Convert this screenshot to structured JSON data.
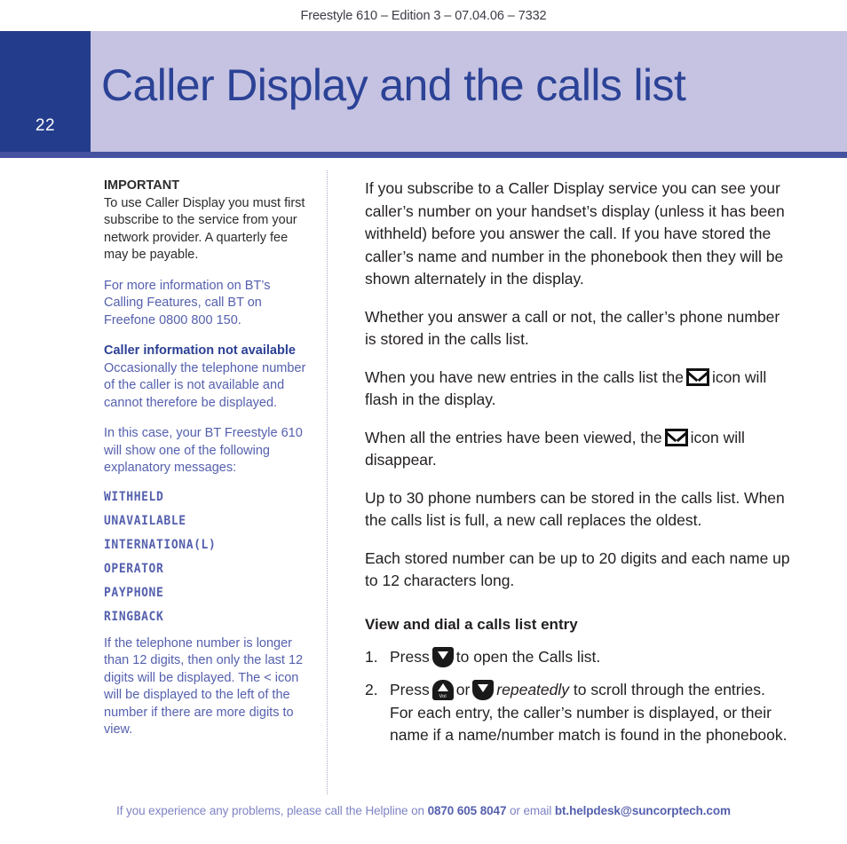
{
  "running_header": "Freestyle 610 – Edition 3 – 07.04.06 – 7332",
  "page_number": "22",
  "title": "Caller Display and the calls list",
  "colors": {
    "page_block": "#243c8c",
    "banner": "#c5c3e1",
    "title_blue": "#2b4296",
    "rule": "#4552a0",
    "body_blue": "#5560ae",
    "body_dark": "#231f20",
    "footer": "#7f84c4"
  },
  "sidebar": {
    "important_heading": "IMPORTANT",
    "important_text": "To use Caller Display you must first subscribe to the service from your network provider. A quarterly fee may be payable.",
    "more_info_text": "For more information on BT’s Calling Features, call BT on Freefone 0800 800 150.",
    "not_available_heading": "Caller information not available",
    "not_available_text": "Occasionally the telephone number of the caller is not available and cannot therefore be displayed.",
    "in_this_case_text": "In this case, your BT Freestyle 610 will show one of the following explanatory messages:",
    "display_messages": [
      "WITHHELD",
      "UNAVAILABLE",
      "INTERNATIONA(L)",
      "OPERATOR",
      "PAYPHONE",
      "RINGBACK"
    ],
    "long_number_text": "If the telephone number is longer than 12 digits, then only the last 12 digits will be displayed. The < icon will be displayed to the left of the number if there are more digits to view."
  },
  "main": {
    "para_subscribe": "If you subscribe to a Caller Display service you can see your caller’s number on your handset’s display (unless it has been withheld) before you answer the call. If you have stored the caller’s name and number in the phonebook then they will be shown alternately in the display.",
    "para_whether": "Whether you answer a call or not, the caller’s phone number is stored in the calls list.",
    "para_new_entries_pre": "When you have new entries in the calls list the",
    "para_new_entries_post": "icon will flash in the display.",
    "para_viewed_pre": "When all the entries have been viewed, the",
    "para_viewed_post": "icon will disappear.",
    "para_capacity": "Up to 30 phone numbers can be stored in the calls list. When the calls list is full, a new call replaces the oldest.",
    "para_limits": "Each stored number can be up to 20 digits and each name up to 12 characters long.",
    "section_heading": "View and dial a calls list entry",
    "step1": {
      "num": "1.",
      "pre": "Press",
      "post": "to open the Calls list."
    },
    "step2": {
      "num": "2.",
      "pre": "Press",
      "mid": "or",
      "emphasis": "repeatedly",
      "post": "to scroll through the entries. For each entry, the caller’s number is displayed, or their name if a name/number match is found in the phonebook."
    },
    "key_vol_label": "Vol"
  },
  "footer": {
    "lead": "If you experience any problems, please call the Helpline on",
    "phone": "0870 605 8047",
    "middle": "or email",
    "email": "bt.helpdesk@suncorptech.com"
  }
}
